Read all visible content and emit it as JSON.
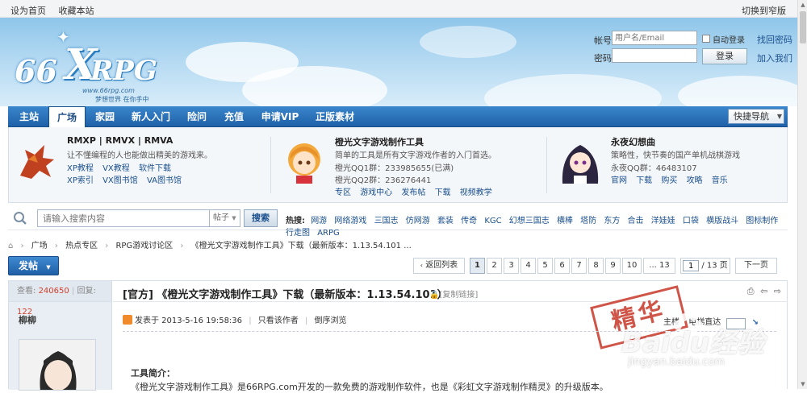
{
  "topbar": {
    "set_home": "设为首页",
    "bookmark": "收藏本站",
    "switch_width": "切换到窄版"
  },
  "logo": {
    "number": "66",
    "letter": "X",
    "name": "RPG",
    "url": "www.66rpg.com",
    "slogan": "梦想世界 在你手中"
  },
  "login": {
    "account_label": "帐号",
    "account_placeholder": "用户名/Email",
    "auto_login": "自动登录",
    "find_password": "找回密码",
    "password_label": "密码",
    "login_button": "登录",
    "join": "加入我们"
  },
  "nav": {
    "items": [
      "主站",
      "广场",
      "家园",
      "新人入门",
      "险问",
      "充值",
      "申请VIP",
      "正版素材"
    ],
    "active": "广场",
    "quick_nav": "快捷导航"
  },
  "featured": [
    {
      "title": "RMXP | RMVX | RMVA",
      "desc": "让不懂编程的人也能做出精美的游戏来。",
      "links1": [
        "XP教程",
        "VX教程",
        "软件下载"
      ],
      "links2": [
        "XP索引",
        "VX图书馆",
        "VA图书馆"
      ]
    },
    {
      "title": "橙光文字游戏制作工具",
      "desc": "简单的工具是所有文字游戏作者的入门首选。",
      "qq1": "橙光QQ1群：233985655(已满)",
      "qq2": "橙光QQ2群：236276441",
      "links": [
        "专区",
        "游戏中心",
        "发布帖",
        "下载",
        "视频教学"
      ]
    },
    {
      "title": "永夜幻想曲",
      "desc": "策略性，快节奏的国产单机战棋游戏",
      "qq": "永夜QQ群：46483107",
      "links": [
        "官网",
        "下载",
        "购买",
        "攻略",
        "音乐"
      ]
    }
  ],
  "search": {
    "placeholder": "请输入搜索内容",
    "type": "帖子",
    "button": "搜索",
    "hot_label": "热搜:",
    "hot": [
      "网游",
      "网络游戏",
      "三国志",
      "仿网游",
      "套装",
      "传奇",
      "KGC",
      "幻想三国志",
      "横棒",
      "塔防",
      "东方",
      "合击",
      "洋娃娃",
      "口袋",
      "横版战斗",
      "图标制作",
      "行走图",
      "ARPG"
    ]
  },
  "breadcrumb": [
    "广场",
    "热点专区",
    "RPG游戏讨论区",
    "《橙光文字游戏制作工具》下载（最新版本：1.13.54.101 ..."
  ],
  "actions": {
    "post_button": "发帖"
  },
  "pager": {
    "back": "返回列表",
    "pages": [
      "1",
      "2",
      "3",
      "4",
      "5",
      "6",
      "7",
      "8",
      "9",
      "10",
      "... 13"
    ],
    "current": "1",
    "input_value": "1",
    "total": "/ 13 页",
    "next": "下一页"
  },
  "thread": {
    "views_label": "查看:",
    "views": "240650",
    "replies_label": "回复:",
    "replies": "122",
    "author": "柳柳",
    "title": "[官方] 《橙光文字游戏制作工具》下载（最新版本：1.13.54.101）",
    "copy_link": "[复制链接]",
    "posted": "发表于 2013-5-16 19:58:36",
    "only_author": "只看该作者",
    "reverse": "倒序浏览",
    "floor": "主楼",
    "floor_jump": "电梯直达",
    "stamp": "精华",
    "intro_heading": "工具简介：",
    "intro_text": "《橙光文字游戏制作工具》是66RPG.com开发的一款免费的游戏制作软件，也是《彩虹文字游戏制作精灵》的升级版本。"
  },
  "watermark": {
    "brand": "Baidu经验",
    "url": "jingyan.baidu.com"
  }
}
